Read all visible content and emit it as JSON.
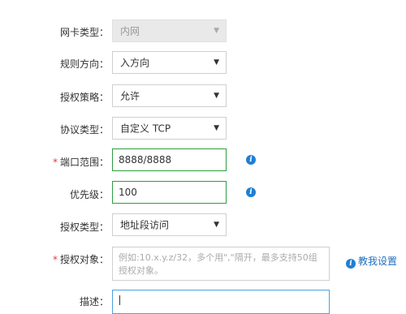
{
  "form": {
    "nic_type": {
      "label": "网卡类型：",
      "value": "内网",
      "disabled": true
    },
    "rule_direction": {
      "label": "规则方向：",
      "value": "入方向"
    },
    "auth_policy": {
      "label": "授权策略：",
      "value": "允许"
    },
    "protocol_type": {
      "label": "协议类型：",
      "value": "自定义 TCP"
    },
    "port_range": {
      "required_mark": "*",
      "label": "端口范围：",
      "value": "8888/8888"
    },
    "priority": {
      "label": "优先级：",
      "value": "100"
    },
    "auth_type": {
      "label": "授权类型：",
      "value": "地址段访问"
    },
    "auth_object": {
      "required_mark": "*",
      "label": "授权对象：",
      "placeholder": "例如:10.x.y.z/32，多个用\",\"隔开，最多支持50组授权对象。",
      "help_link": "教我设置"
    },
    "description": {
      "label": "描述：",
      "value": ""
    }
  },
  "icons": {
    "dropdown": "caret-down-icon",
    "info": "info-icon"
  },
  "colors": {
    "valid_border": "#2e9e3f",
    "focus_border": "#4aa3e0",
    "required": "#e4393c",
    "info": "#1f7fd4",
    "link": "#1f6fbf",
    "disabled_bg": "#e9e9e9"
  }
}
